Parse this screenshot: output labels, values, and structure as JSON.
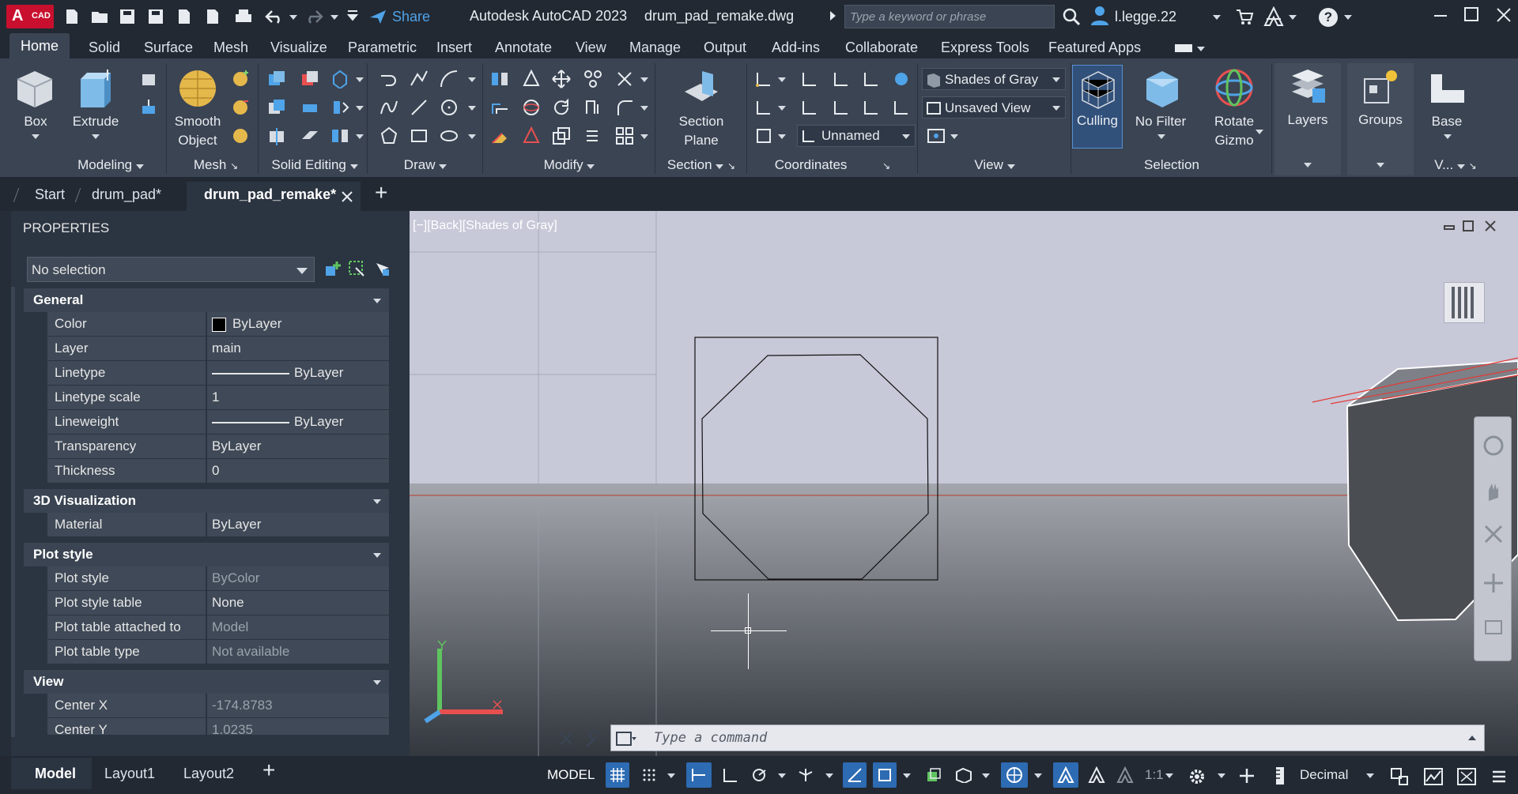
{
  "title_bar": {
    "app_badge": "A",
    "app_badge_sub": "CAD",
    "share_label": "Share",
    "app_name": "Autodesk AutoCAD 2023",
    "file_name": "drum_pad_remake.dwg",
    "search_placeholder": "Type a keyword or phrase",
    "user_name": "l.legge.22",
    "help_label": "?"
  },
  "menu_tabs": [
    "Home",
    "Solid",
    "Surface",
    "Mesh",
    "Visualize",
    "Parametric",
    "Insert",
    "Annotate",
    "View",
    "Manage",
    "Output",
    "Add-ins",
    "Collaborate",
    "Express Tools",
    "Featured Apps"
  ],
  "ribbon": {
    "box_label": "Box",
    "extrude_label": "Extrude",
    "smooth_object_label": "Smooth Object",
    "section_plane_label": "Section Plane",
    "visual_style": "Shades of Gray",
    "saved_view": "Unsaved View",
    "ucs_name": "Unnamed",
    "culling_label": "Culling",
    "no_filter_label": "No Filter",
    "rotate_gizmo_label": "Rotate Gizmo",
    "layers_label": "Layers",
    "groups_label": "Groups",
    "base_label": "Base",
    "panels": {
      "modeling": "Modeling",
      "mesh": "Mesh",
      "solid_editing": "Solid Editing",
      "draw": "Draw",
      "modify": "Modify",
      "section": "Section",
      "coordinates": "Coordinates",
      "view": "View",
      "selection": "Selection",
      "view_short": "V..."
    }
  },
  "doc_tabs": {
    "start": "Start",
    "tab1": "drum_pad*",
    "tab2": "drum_pad_remake*",
    "new_tab": "+"
  },
  "properties": {
    "header": "PROPERTIES",
    "selection": "No selection",
    "general": {
      "title": "General",
      "rows": [
        {
          "k": "Color",
          "v": "ByLayer"
        },
        {
          "k": "Layer",
          "v": "main"
        },
        {
          "k": "Linetype",
          "v": "ByLayer"
        },
        {
          "k": "Linetype scale",
          "v": "1"
        },
        {
          "k": "Lineweight",
          "v": "ByLayer"
        },
        {
          "k": "Transparency",
          "v": "ByLayer"
        },
        {
          "k": "Thickness",
          "v": "0"
        }
      ]
    },
    "viz": {
      "title": "3D Visualization",
      "rows": [
        {
          "k": "Material",
          "v": "ByLayer"
        }
      ]
    },
    "plot": {
      "title": "Plot style",
      "rows": [
        {
          "k": "Plot style",
          "v": "ByColor"
        },
        {
          "k": "Plot style table",
          "v": "None"
        },
        {
          "k": "Plot table attached to",
          "v": "Model"
        },
        {
          "k": "Plot table type",
          "v": "Not available"
        }
      ]
    },
    "view": {
      "title": "View",
      "rows": [
        {
          "k": "Center X",
          "v": "-174.8783"
        },
        {
          "k": "Center Y",
          "v": "1.0235"
        }
      ]
    }
  },
  "viewport": {
    "label": "[−][Back][Shades of Gray]",
    "command_placeholder": "Type a command"
  },
  "status_bar": {
    "model_tab": "Model",
    "layout1": "Layout1",
    "layout2": "Layout2",
    "add_layout": "+",
    "model_button": "MODEL",
    "scale": "1:1",
    "units": "Decimal"
  }
}
